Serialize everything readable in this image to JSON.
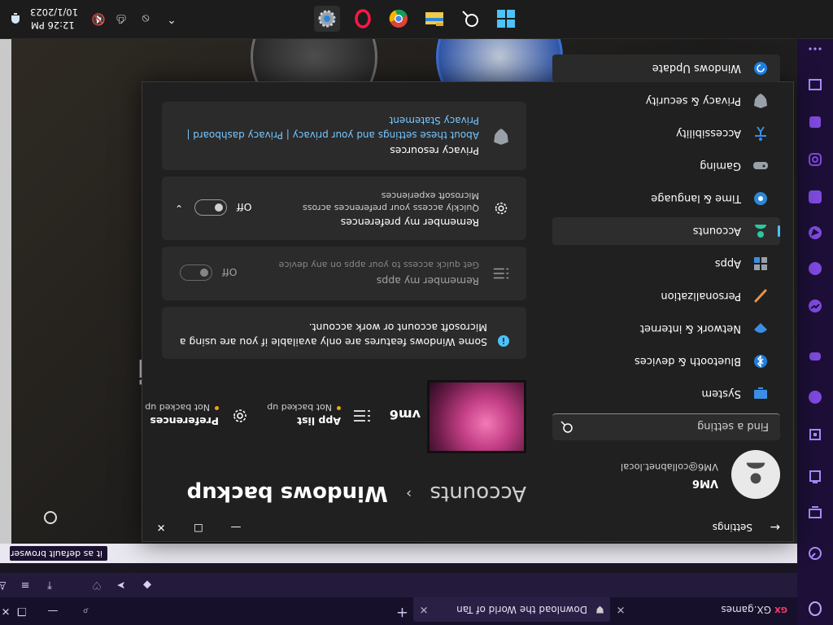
{
  "browser": {
    "tabs": [
      {
        "label": "GX.games"
      },
      {
        "label": "Download the World of Tan"
      }
    ],
    "notification": {
      "text": "it as default browser"
    }
  },
  "settings": {
    "app_title": "Settings",
    "user": {
      "name": "VM6",
      "email": "VM6@collabnet.local"
    },
    "search": {
      "placeholder": "Find a setting"
    },
    "nav": [
      {
        "label": "System",
        "icon": "monitor-icon"
      },
      {
        "label": "Bluetooth & devices",
        "icon": "bluetooth-icon"
      },
      {
        "label": "Network & internet",
        "icon": "wifi-icon"
      },
      {
        "label": "Personalization",
        "icon": "brush-icon"
      },
      {
        "label": "Apps",
        "icon": "apps-icon"
      },
      {
        "label": "Accounts",
        "icon": "person-icon"
      },
      {
        "label": "Time & language",
        "icon": "globe-clock-icon"
      },
      {
        "label": "Gaming",
        "icon": "gamepad-icon"
      },
      {
        "label": "Accessibility",
        "icon": "accessibility-icon"
      },
      {
        "label": "Privacy & security",
        "icon": "shield-icon"
      },
      {
        "label": "Windows Update",
        "icon": "refresh-icon"
      }
    ],
    "active_nav": "Accounts",
    "breadcrumb": {
      "parent": "Accounts",
      "separator": "›",
      "current": "Windows backup"
    },
    "device": {
      "name": "vm6"
    },
    "backup_status": [
      {
        "title": "App list",
        "status": "Not backed up"
      },
      {
        "title": "Preferences",
        "status": "Not backed up"
      }
    ],
    "info_banner": {
      "text": "Some Windows features are only available if you are using a Microsoft account or work account."
    },
    "remember_apps": {
      "title": "Remember my apps",
      "desc": "Get quick access to your apps on any device",
      "toggle": "Off"
    },
    "remember_prefs": {
      "title": "Remember my preferences",
      "desc": "Quickly access your preferences across Microsoft experiences",
      "toggle": "Off"
    },
    "privacy": {
      "title": "Privacy resources",
      "links": "About these settings and your privacy | Privacy dashboard |",
      "statement": "Privacy Statement"
    }
  },
  "taskbar": {
    "clock_time": "12:26 PM",
    "clock_date": "10/1/2023"
  },
  "colors": {
    "accent": "#4cc2ff",
    "link": "#76c7ff",
    "warning": "#f0a30a"
  }
}
